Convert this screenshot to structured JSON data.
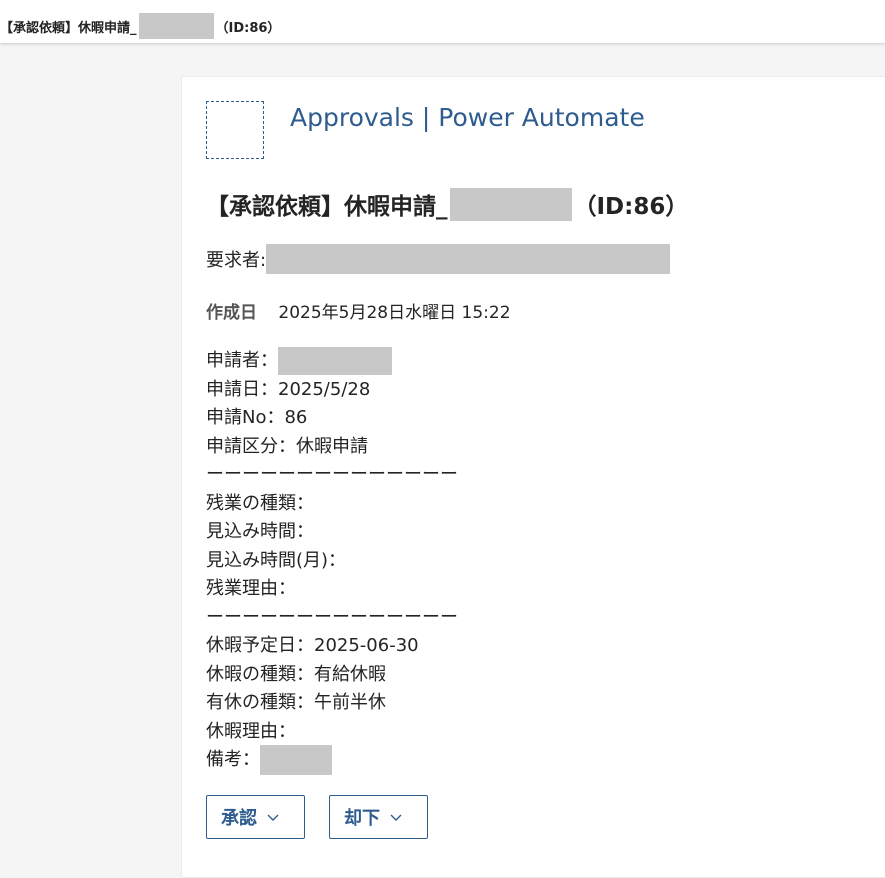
{
  "topbar": {
    "title_prefix": "【承認依頼】休暇申請_",
    "title_suffix": "（ID:86）"
  },
  "card": {
    "app_name": "Approvals | Power Automate",
    "heading_prefix": "【承認依頼】休暇申請_",
    "heading_suffix": "（ID:86）",
    "requester_label": "要求者:",
    "created_label": "作成日",
    "created_value": "2025年5月28日水曜日 15:22",
    "details": {
      "applicant_label": "申請者：",
      "apply_date": "申請日：2025/5/28",
      "apply_no": "申請No：86",
      "apply_category": "申請区分：休暇申請",
      "divider1": "ーーーーーーーーーーーーーー",
      "overtime_type": "残業の種類：",
      "expected_hours": "見込み時間：",
      "expected_hours_month": "見込み時間(月)：",
      "overtime_reason": "残業理由：",
      "divider2": "ーーーーーーーーーーーーーー",
      "leave_date": "休暇予定日：2025-06-30",
      "leave_type": "休暇の種類：有給休暇",
      "paid_leave_type": "有休の種類：午前半休",
      "leave_reason": "休暇理由：",
      "remarks_label": "備考："
    },
    "buttons": {
      "approve": "承認",
      "reject": "却下"
    }
  },
  "colors": {
    "accent": "#2f5c8f",
    "redaction": "#c8c8c8"
  },
  "icons": {
    "chevron": "chevron-down-icon"
  }
}
